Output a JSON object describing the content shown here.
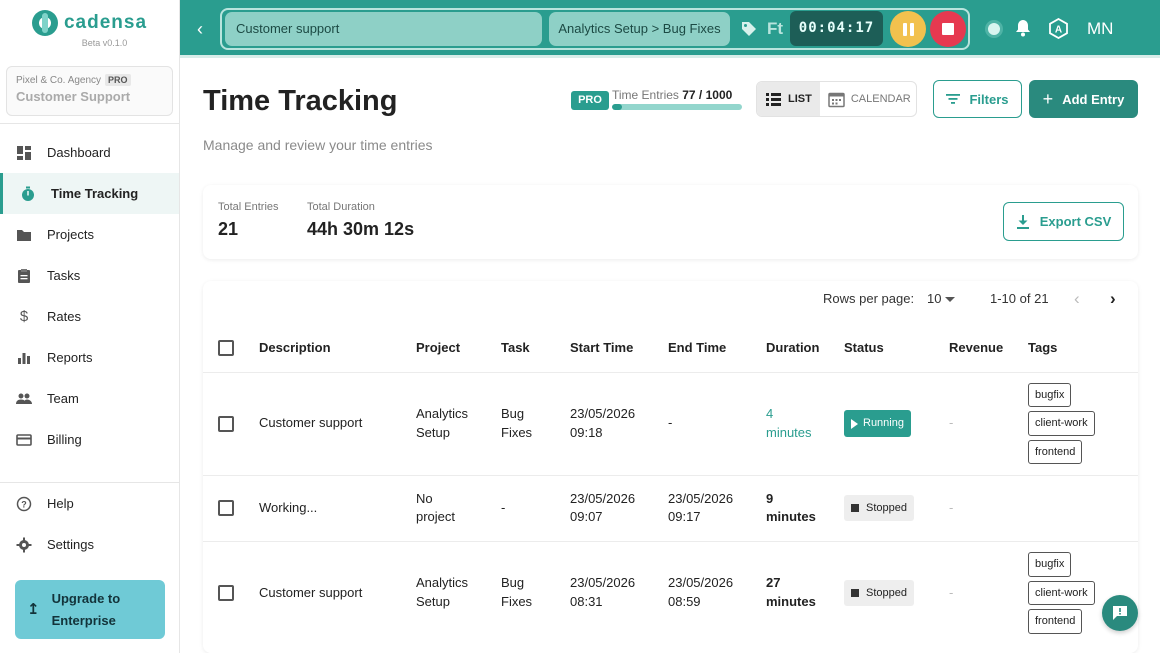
{
  "brand": {
    "name": "cadensa",
    "version": "Beta v0.1.0"
  },
  "workspace": {
    "agency": "Pixel & Co. Agency",
    "plan_badge": "PRO",
    "client": "Customer Support"
  },
  "sidebar": {
    "items": [
      {
        "label": "Dashboard",
        "icon": "dashboard-icon"
      },
      {
        "label": "Time Tracking",
        "icon": "stopwatch-icon",
        "active": true
      },
      {
        "label": "Projects",
        "icon": "folder-icon"
      },
      {
        "label": "Tasks",
        "icon": "clipboard-icon"
      },
      {
        "label": "Rates",
        "icon": "dollar-icon"
      },
      {
        "label": "Reports",
        "icon": "bar-chart-icon"
      },
      {
        "label": "Team",
        "icon": "people-icon"
      },
      {
        "label": "Billing",
        "icon": "credit-card-icon"
      }
    ],
    "bottom_items": [
      {
        "label": "Help",
        "icon": "help-icon"
      },
      {
        "label": "Settings",
        "icon": "gear-icon"
      }
    ],
    "upgrade_label_line1": "Upgrade to",
    "upgrade_label_line2": "Enterprise"
  },
  "topbar": {
    "description": "Customer support",
    "project_task": "Analytics Setup > Bug Fixes",
    "tag_abbrev": "Ft",
    "timer": "00:04:17",
    "user_initials": "MN"
  },
  "header": {
    "title": "Time Tracking",
    "subtitle": "Manage and review your time entries",
    "pro_badge": "PRO",
    "entries_label": "Time Entries",
    "entries_count": "77 / 1000",
    "entries_fraction": 0.077,
    "view_list": "LIST",
    "view_calendar": "CALENDAR",
    "filters": "Filters",
    "add_entry": "Add Entry"
  },
  "stats": {
    "total_entries_label": "Total Entries",
    "total_entries": "21",
    "total_duration_label": "Total Duration",
    "total_duration": "44h 30m 12s",
    "export": "Export CSV"
  },
  "pagination": {
    "rows_per_page_label": "Rows per page:",
    "rows_per_page": "10",
    "range": "1-10 of 21"
  },
  "table": {
    "columns": [
      "Description",
      "Project",
      "Task",
      "Start Time",
      "End Time",
      "Duration",
      "Status",
      "Revenue",
      "Tags"
    ],
    "rows": [
      {
        "description": "Customer support",
        "project_l1": "Analytics",
        "project_l2": "Setup",
        "task_l1": "Bug",
        "task_l2": "Fixes",
        "start_l1": "23/05/2026",
        "start_l2": "09:18",
        "end_l1": "-",
        "end_l2": "",
        "duration_l1": "4",
        "duration_l2": "minutes",
        "status": "Running",
        "revenue": "-",
        "tags": [
          "bugfix",
          "client-work",
          "frontend"
        ]
      },
      {
        "description": "Working...",
        "project_l1": "No",
        "project_l2": "project",
        "task_l1": "-",
        "task_l2": "",
        "start_l1": "23/05/2026",
        "start_l2": "09:07",
        "end_l1": "23/05/2026",
        "end_l2": "09:17",
        "duration_l1": "9",
        "duration_l2": "minutes",
        "status": "Stopped",
        "revenue": "-",
        "tags": []
      },
      {
        "description": "Customer support",
        "project_l1": "Analytics",
        "project_l2": "Setup",
        "task_l1": "Bug",
        "task_l2": "Fixes",
        "start_l1": "23/05/2026",
        "start_l2": "08:31",
        "end_l1": "23/05/2026",
        "end_l2": "08:59",
        "duration_l1": "27",
        "duration_l2": "minutes",
        "status": "Stopped",
        "revenue": "-",
        "tags": [
          "bugfix",
          "client-work",
          "frontend"
        ]
      }
    ]
  },
  "colors": {
    "accent": "#2a9d8f",
    "running": "#2a9d8f",
    "pause": "#f2c14e",
    "stop": "#e63950",
    "upgrade": "#6fcad6"
  }
}
